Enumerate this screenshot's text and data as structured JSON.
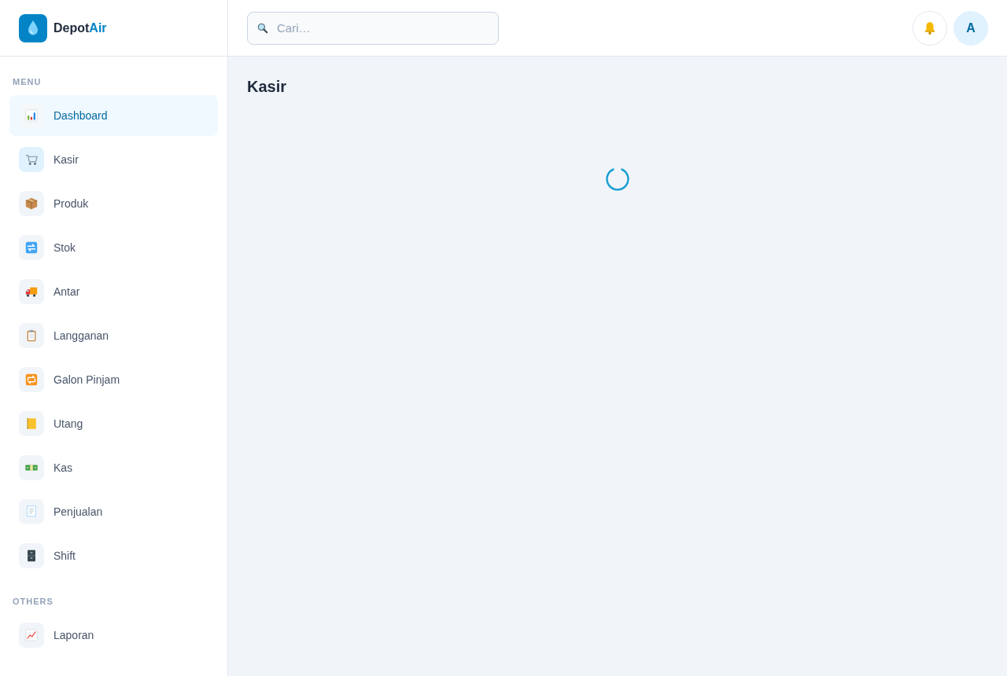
{
  "brand": {
    "name": "Depot",
    "accent": "Air"
  },
  "search": {
    "placeholder": "Cari…"
  },
  "avatar": {
    "initial": "A"
  },
  "sidebar": {
    "sections": [
      {
        "heading": "MENU",
        "items": [
          {
            "label": "Dashboard",
            "selected": true,
            "icon_highlighted": false
          },
          {
            "label": "Kasir",
            "selected": false,
            "icon_highlighted": true
          },
          {
            "label": "Produk",
            "selected": false,
            "icon_highlighted": false
          },
          {
            "label": "Stok",
            "selected": false,
            "icon_highlighted": false
          },
          {
            "label": "Antar",
            "selected": false,
            "icon_highlighted": false
          },
          {
            "label": "Langganan",
            "selected": false,
            "icon_highlighted": false
          },
          {
            "label": "Galon Pinjam",
            "selected": false,
            "icon_highlighted": false
          },
          {
            "label": "Utang",
            "selected": false,
            "icon_highlighted": false
          },
          {
            "label": "Kas",
            "selected": false,
            "icon_highlighted": false
          },
          {
            "label": "Penjualan",
            "selected": false,
            "icon_highlighted": false
          },
          {
            "label": "Shift",
            "selected": false,
            "icon_highlighted": false
          }
        ]
      },
      {
        "heading": "OTHERS",
        "items": [
          {
            "label": "Laporan",
            "selected": false,
            "icon_highlighted": false
          }
        ]
      }
    ]
  },
  "page": {
    "title": "Kasir",
    "loading": true
  }
}
